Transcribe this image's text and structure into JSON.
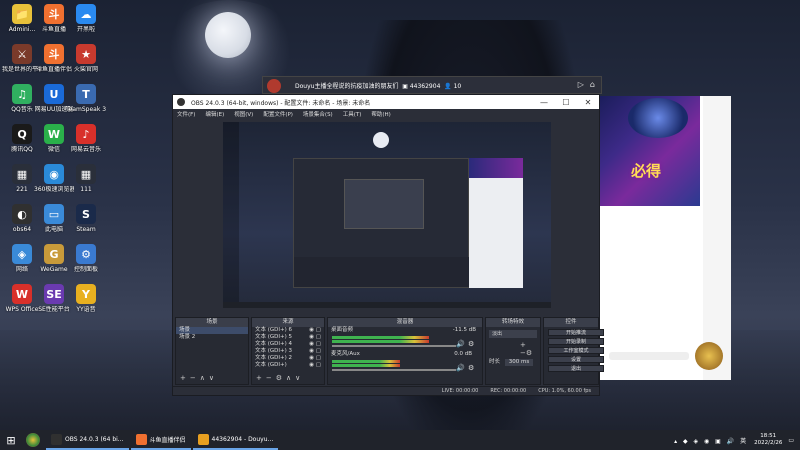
{
  "desktop": {
    "icons": [
      {
        "label": "Admini...",
        "color": "#e8c13a",
        "glyph": "📁"
      },
      {
        "label": "斗鱼直播",
        "color": "#f07030",
        "glyph": "斗"
      },
      {
        "label": "开黑啦",
        "color": "#2a8af0",
        "glyph": "☁"
      },
      {
        "label": "我是世界的平台",
        "color": "#7a3a2a",
        "glyph": "⚔"
      },
      {
        "label": "斗鱼直播伴侣",
        "color": "#f07030",
        "glyph": "斗"
      },
      {
        "label": "火柴官网",
        "color": "#c83a2e",
        "glyph": "★"
      },
      {
        "label": "QQ音乐",
        "color": "#30b060",
        "glyph": "♫"
      },
      {
        "label": "网易UU加速器",
        "color": "#1a6ad8",
        "glyph": "U"
      },
      {
        "label": "TeamSpeak 3",
        "color": "#3a6ab0",
        "glyph": "T"
      },
      {
        "label": "腾讯QQ",
        "color": "#1a1a1a",
        "glyph": "Q"
      },
      {
        "label": "微信",
        "color": "#2ab04a",
        "glyph": "W"
      },
      {
        "label": "网易云音乐",
        "color": "#d8302a",
        "glyph": "♪"
      },
      {
        "label": "221",
        "color": "#2a2f3a",
        "glyph": "▦"
      },
      {
        "label": "360极速浏览器",
        "color": "#2a8ad8",
        "glyph": "◉"
      },
      {
        "label": "111",
        "color": "#2a2f3a",
        "glyph": "▦"
      },
      {
        "label": "obs64",
        "color": "#303030",
        "glyph": "◐"
      },
      {
        "label": "此电脑",
        "color": "#3a8ad8",
        "glyph": "▭"
      },
      {
        "label": "Steam",
        "color": "#1a2a4a",
        "glyph": "S"
      },
      {
        "label": "网络",
        "color": "#3a8ad8",
        "glyph": "◈"
      },
      {
        "label": "WeGame",
        "color": "#c89a3a",
        "glyph": "G"
      },
      {
        "label": "控制面板",
        "color": "#3a7ad0",
        "glyph": "⚙"
      },
      {
        "label": "WPS Office",
        "color": "#d8302a",
        "glyph": "W"
      },
      {
        "label": "SE性能平台",
        "color": "#6a3ab0",
        "glyph": "SE"
      },
      {
        "label": "YY语音",
        "color": "#e8b020",
        "glyph": "Y"
      }
    ]
  },
  "douyu_window": {
    "title": "Douyu主播全程说的抗疫加油的朋友们",
    "room_id": "44362904",
    "viewers": "10"
  },
  "side_panel": {
    "banner_text": "必得"
  },
  "obs": {
    "title": "OBS 24.0.3 (64-bit, windows) - 配置文件: 未命名 - 场景: 未命名",
    "menu": [
      "文件(F)",
      "编辑(E)",
      "视图(V)",
      "配置文件(P)",
      "场景集合(S)",
      "工具(T)",
      "帮助(H)"
    ],
    "docks": {
      "scenes": {
        "title": "场景",
        "items": [
          "场景",
          "场景 2"
        ]
      },
      "sources": {
        "title": "来源",
        "items": [
          "文本 (GDI+) 6",
          "文本 (GDI+) 5",
          "文本 (GDI+) 4",
          "文本 (GDI+) 3",
          "文本 (GDI+) 2",
          "文本 (GDI+)"
        ]
      },
      "mixer": {
        "title": "混音器",
        "tracks": [
          {
            "name": "桌面音频",
            "db": "-11.5 dB",
            "level": 0.78
          },
          {
            "name": "麦克风/Aux",
            "db": "0.0 dB",
            "level": 0.55
          }
        ]
      },
      "transitions": {
        "title": "转场特效",
        "type": "淡出",
        "duration_label": "时长",
        "duration": "300 ms"
      },
      "controls": {
        "title": "控件",
        "buttons": [
          "开始推流",
          "开始录制",
          "工作室模式",
          "设置",
          "退出"
        ]
      }
    },
    "status": {
      "live": "LIVE: 00:00:00",
      "rec": "REC: 00:00:00",
      "cpu": "CPU: 1.0%, 60.00 fps"
    }
  },
  "taskbar": {
    "items": [
      {
        "label": "OBS 24.0.3 (64 bi...",
        "color": "#303030"
      },
      {
        "label": "斗鱼直播伴侣",
        "color": "#f07030"
      },
      {
        "label": "44362904 - Douyu...",
        "color": "#e8a020"
      }
    ],
    "time": "18:51",
    "date": "2022/2/26"
  }
}
